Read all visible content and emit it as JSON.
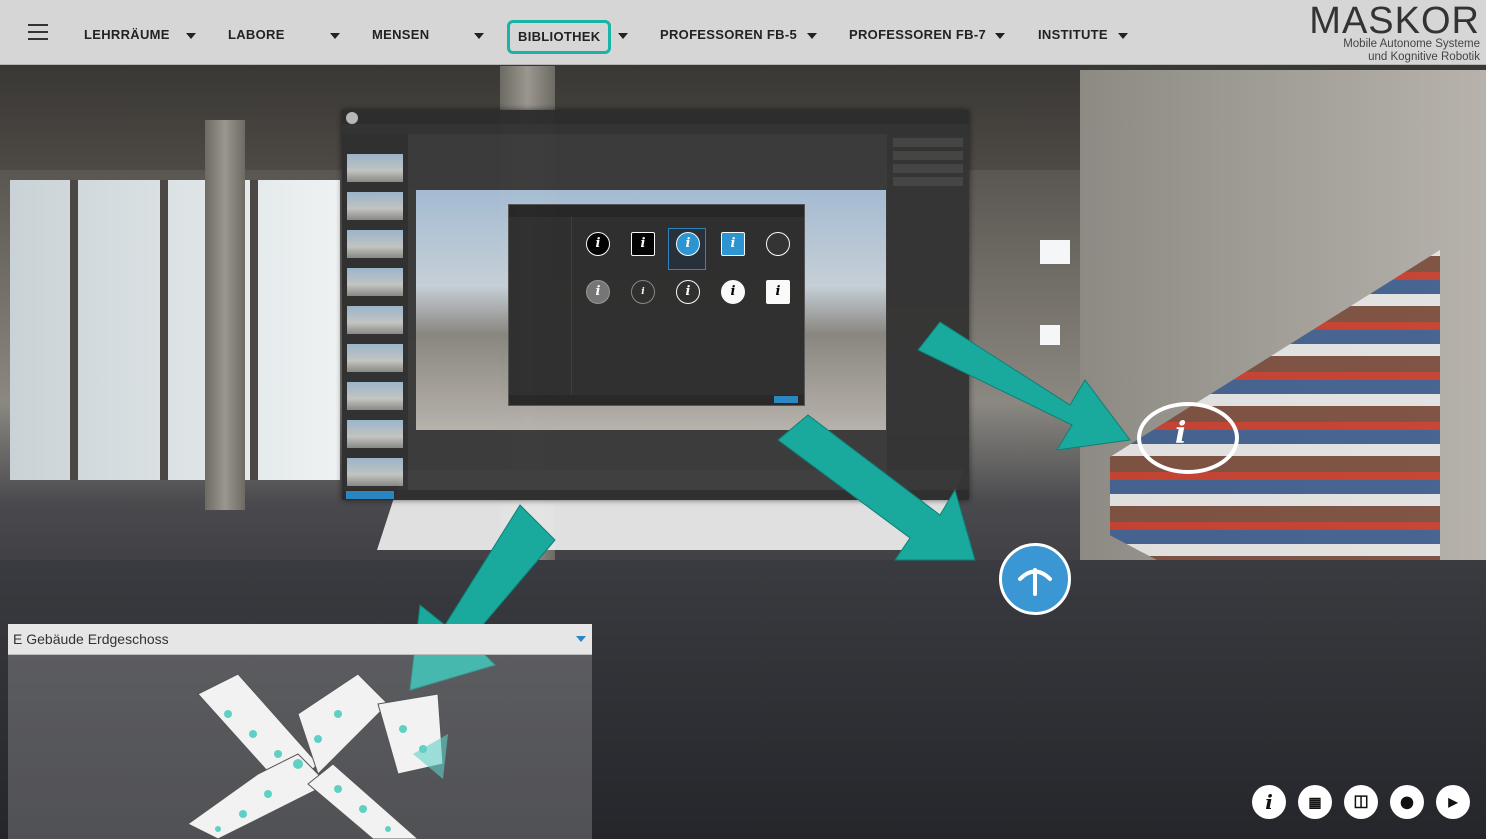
{
  "nav": {
    "menu_icon": "hamburger-icon",
    "items": [
      {
        "label": "LEHRRÄUME"
      },
      {
        "label": "LABORE"
      },
      {
        "label": "MENSEN"
      },
      {
        "label": "BIBLIOTHEK",
        "active": true
      },
      {
        "label": "PROFESSOREN FB-5"
      },
      {
        "label": "PROFESSOREN FB-7"
      },
      {
        "label": "INSTITUTE"
      }
    ],
    "active_color": "#19b3a7"
  },
  "logo": {
    "title": "MASKOR",
    "subtitle_line1": "Mobile Autonome Systeme",
    "subtitle_line2": "und Kognitive Robotik"
  },
  "map": {
    "floor_selector_value": "E Gebäude Erdgeschoss",
    "accent_color": "#2b86c5"
  },
  "hotspots": {
    "info_icon": "info-icon",
    "navigation_icon": "arrow-up-icon",
    "hotspot_color": "#3b97d3"
  },
  "arrow_color": "#19a99d",
  "controls": [
    {
      "icon": "info-icon",
      "glyph": "i"
    },
    {
      "icon": "thumbnails-icon",
      "glyph": "▦"
    },
    {
      "icon": "floorplan-icon",
      "glyph": "◫"
    },
    {
      "icon": "map-pin-icon",
      "glyph": "⬤"
    },
    {
      "icon": "play-video-icon",
      "glyph": "▶"
    }
  ],
  "editor": {
    "dialog_cells": [
      {
        "glyph": "i"
      },
      {
        "glyph": "i"
      },
      {
        "glyph": "i"
      },
      {
        "glyph": "i"
      },
      {
        "glyph": ""
      },
      {
        "glyph": "i"
      },
      {
        "glyph": "i"
      },
      {
        "glyph": "i"
      },
      {
        "glyph": "i"
      },
      {
        "glyph": "i"
      }
    ]
  }
}
